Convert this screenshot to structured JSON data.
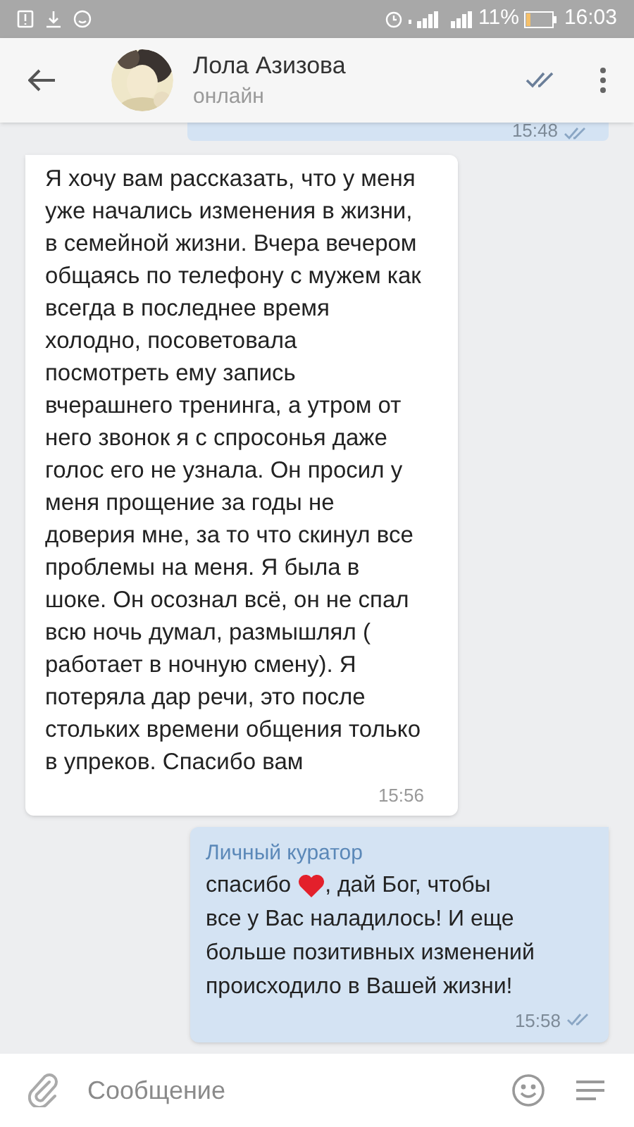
{
  "status_bar": {
    "battery": "11%",
    "time": "16:03"
  },
  "header": {
    "name": "Лола Азизова",
    "status": "онлайн"
  },
  "messages": [
    {
      "kind": "outgoing_partial",
      "time": "15:48",
      "read": true
    },
    {
      "kind": "incoming",
      "text": "Я хочу вам рассказать, что у меня уже начались изменения в жизни, в семейной жизни. Вчера вечером общаясь по телефону с мужем как всегда в последнее время холодно, посоветовала посмотреть ему запись вчерашнего тренинга, а утром от него звонок я с спросонья даже голос его не узнала. Он просил у меня прощение за годы не доверия мне, за то что скинул все проблемы на меня. Я была в шоке. Он осознал всё, он не спал всю ночь думал, размышлял ( работает в ночную смену). Я потеряла дар речи, это после стольких времени общения только в упреков. Спасибо вам",
      "time": "15:56"
    },
    {
      "kind": "outgoing",
      "sender": "Личный куратор",
      "text_before": "спасибо",
      "text_after": ", дай Бог, чтобы",
      "text_continued": "все у Вас наладилось! И еще больше позитивных изменений происходило в Вашей жизни!",
      "time": "15:58",
      "read": true
    }
  ],
  "composer": {
    "placeholder": "Сообщение"
  }
}
